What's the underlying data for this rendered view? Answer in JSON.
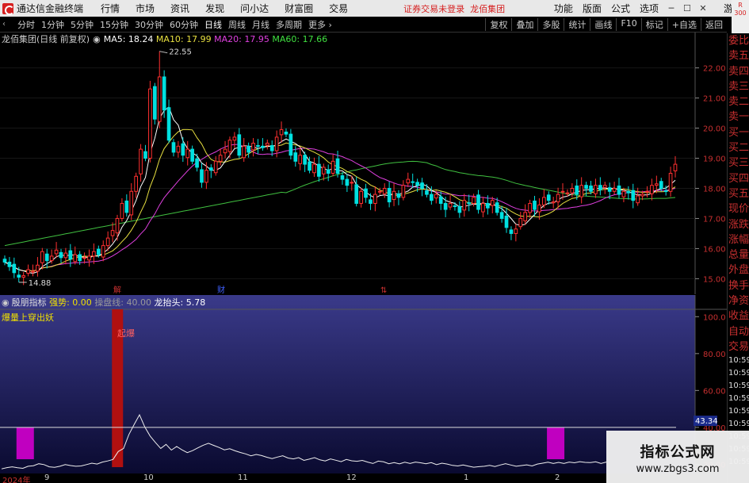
{
  "app": {
    "title": "通达信金融终端",
    "menu": [
      "行情",
      "市场",
      "资讯",
      "发现",
      "问小达",
      "财富圈",
      "交易"
    ],
    "broker_status": "证券交易未登录",
    "stock_badge": "龙佰集团",
    "right_menu": [
      "功能",
      "版面",
      "公式",
      "选项"
    ],
    "guest": "游客",
    "r_badge": "R 300"
  },
  "toolbar": {
    "periods": [
      "分时",
      "1分钟",
      "5分钟",
      "15分钟",
      "30分钟",
      "60分钟",
      "日线",
      "周线",
      "月线",
      "多周期",
      "更多"
    ],
    "active": "日线",
    "tools": [
      "复权",
      "叠加",
      "多股",
      "统计",
      "画线",
      "F10",
      "标记",
      "+自选",
      "返回"
    ]
  },
  "chart_header": {
    "stock": "龙佰集团(日线 前复权)",
    "ma5": "MA5: 18.24",
    "ma10": "MA10: 17.99",
    "ma20": "MA20: 17.95",
    "ma60": "MA60: 17.66"
  },
  "indicator_header": {
    "name": "殷朋指标",
    "strong": "强势: 0.00",
    "control": "操盘线: 40.00",
    "dragon": "龙抬头: 5.78",
    "title": "爆量上穿出妖",
    "signal": "起爆"
  },
  "sidebar": {
    "items": [
      "委比",
      "卖五",
      "卖四",
      "卖三",
      "卖二",
      "卖一",
      "买一",
      "买二",
      "买三",
      "买四",
      "买五",
      "现价",
      "涨跌",
      "涨幅",
      "总量",
      "外盘",
      "换手",
      "净资",
      "收益"
    ],
    "auto_trade": [
      "自动",
      "交易"
    ],
    "times": [
      "10:59",
      "10:59",
      "10:59",
      "10:59",
      "10:59",
      "10:59",
      "10:59",
      "10:59",
      "10:59"
    ]
  },
  "xaxis": {
    "labels": [
      "2024年",
      "9",
      "10",
      "11",
      "12",
      "1",
      "2"
    ]
  },
  "markers": [
    "解",
    "财",
    "⇅"
  ],
  "watermark": {
    "title": "指标公式网",
    "url": "www.zbgs3.com"
  },
  "colors": {
    "up": "#ff3030",
    "down": "#00e0e0",
    "ma5": "#ffffff",
    "ma10": "#e8e040",
    "ma20": "#e040e0",
    "ma60": "#40c040",
    "indicator_bg": "#20206a",
    "bar_magenta": "#c000c0",
    "bar_red": "#b01010"
  },
  "chart_data": [
    {
      "type": "candlestick",
      "title": "龙佰集团(日线 前复权)",
      "y_axis_labels": [
        "15.00",
        "16.00",
        "17.00",
        "18.00",
        "19.00",
        "20.00",
        "21.00",
        "22.00"
      ],
      "ylim": [
        14.8,
        22.7
      ],
      "annotations": [
        {
          "label": "22.55",
          "value": 22.55
        },
        {
          "label": "14.88",
          "value": 14.88
        }
      ],
      "closes": [
        15.55,
        15.4,
        15.2,
        15.05,
        15.1,
        15.3,
        15.25,
        15.45,
        15.9,
        15.6,
        15.75,
        15.95,
        15.7,
        15.85,
        15.65,
        15.8,
        15.6,
        15.7,
        15.75,
        15.9,
        15.8,
        16.1,
        16.35,
        16.6,
        17.0,
        17.5,
        17.2,
        17.9,
        18.4,
        19.3,
        19.0,
        21.3,
        20.3,
        21.7,
        20.6,
        19.6,
        19.2,
        19.4,
        19.1,
        19.3,
        18.9,
        18.7,
        18.2,
        18.6,
        18.6,
        18.9,
        19.1,
        19.3,
        19.6,
        19.7,
        19.1,
        19.4,
        19.2,
        19.5,
        19.4,
        19.35,
        19.5,
        19.25,
        19.7,
        19.95,
        19.8,
        19.1,
        18.9,
        19.1,
        18.8,
        18.6,
        18.8,
        18.4,
        18.7,
        18.5,
        18.9,
        18.5,
        18.3,
        18.1,
        18.2,
        17.5,
        17.9,
        17.7,
        17.5,
        17.8,
        17.9,
        18.0,
        17.55,
        17.9,
        17.7,
        18.1,
        18.3,
        18.2,
        18.1,
        18.0,
        17.8,
        17.6,
        17.8,
        17.5,
        17.3,
        17.5,
        17.4,
        17.2,
        17.6,
        17.5,
        17.7,
        17.3,
        17.5,
        17.35,
        17.6,
        17.2,
        17.0,
        16.7,
        16.5,
        16.65,
        17.0,
        17.2,
        17.5,
        17.3,
        17.45,
        17.7,
        17.6,
        17.55,
        17.8,
        17.9,
        17.85,
        18.0,
        17.8,
        18.1,
        18.0,
        17.9,
        18.1,
        17.95,
        18.1,
        17.9,
        18.0,
        17.8,
        17.9,
        17.85,
        17.6,
        17.75,
        17.8,
        17.9,
        18.1,
        18.15,
        18.0,
        17.9,
        18.5,
        18.8
      ]
    },
    {
      "type": "line",
      "title": "爆量上穿出妖",
      "y_axis_labels": [
        "20.00",
        "40.00",
        "60.00",
        "80.00",
        "100.0"
      ],
      "ylim": [
        15,
        104
      ],
      "current_value_label": "43.34",
      "reference_line": 40,
      "signal_bars": [
        {
          "x_index": 4,
          "color": "magenta"
        },
        {
          "x_index": 22,
          "color": "red",
          "label": "起爆"
        },
        {
          "x_index": 104,
          "color": "magenta"
        }
      ],
      "values": [
        17.5,
        18.2,
        18.6,
        18.1,
        17.8,
        18.9,
        19.2,
        20.3,
        19.8,
        18.6,
        18.3,
        18.9,
        19.8,
        19.3,
        18.9,
        19.1,
        19.8,
        20.6,
        20.1,
        21.2,
        21.8,
        22.6,
        26.9,
        28.6,
        36.1,
        41.6,
        46.8,
        40.2,
        35.3,
        31.8,
        28.6,
        30.8,
        27.7,
        29.6,
        27.8,
        26.3,
        27.4,
        28.9,
        30.3,
        31.4,
        30.2,
        29.1,
        27.8,
        28.4,
        27.3,
        26.4,
        25.6,
        24.6,
        25.3,
        24.7,
        23.8,
        23.1,
        23.9,
        24.6,
        23.4,
        22.9,
        23.6,
        22.1,
        22.8,
        23.6,
        22.4,
        21.8,
        22.9,
        22.2,
        21.4,
        22.6,
        21.9,
        21.6,
        22.1,
        21.2,
        20.4,
        21.7,
        21.3,
        20.3,
        20.9,
        20.2,
        21.1,
        20.4,
        21.2,
        20.8,
        20.3,
        20.9,
        19.8,
        20.6,
        20.1,
        19.4,
        19.1,
        19.6,
        19.0,
        18.4,
        18.7,
        18.9,
        19.4,
        18.8,
        19.6,
        20.3,
        19.6,
        18.9,
        19.3,
        19.7,
        19.1,
        20.1,
        20.6,
        21.1,
        20.4,
        21.0,
        20.4,
        21.2,
        20.8,
        21.4,
        21.0,
        20.9,
        21.3,
        20.4,
        21.2
      ]
    }
  ]
}
